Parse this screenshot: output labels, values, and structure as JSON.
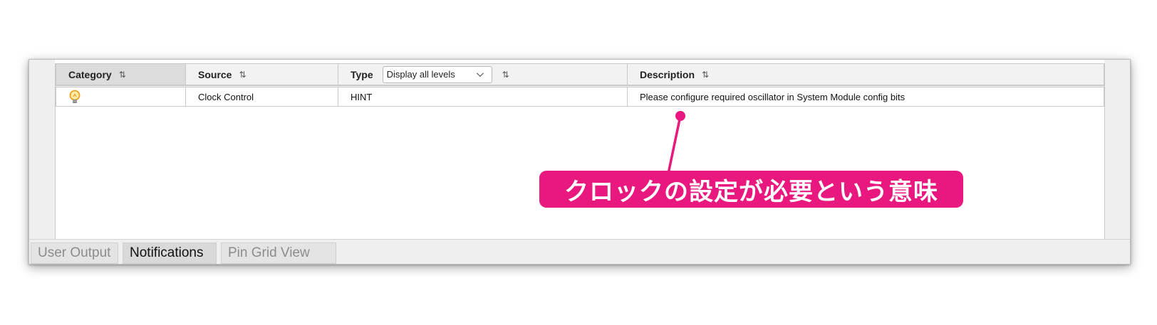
{
  "table": {
    "columns": [
      {
        "label": "Category",
        "sort_icon": "sort-arrows-icon"
      },
      {
        "label": "Source",
        "sort_icon": "sort-arrows-icon"
      },
      {
        "label": "Type",
        "sort_icon": "sort-arrows-icon",
        "filter_value": "Display all levels"
      },
      {
        "label": "Description",
        "sort_icon": "sort-arrows-icon"
      }
    ],
    "sort_glyph": "⇅",
    "rows": [
      {
        "category_icon": "lightbulb-hint-icon",
        "source": "Clock Control",
        "type": "HINT",
        "description": "Please configure required oscillator in System Module config bits"
      }
    ]
  },
  "tabs": [
    {
      "label": "User Output",
      "active": false
    },
    {
      "label": "Notifications",
      "active": true
    },
    {
      "label": "Pin Grid View",
      "active": false
    }
  ],
  "annotation": {
    "text": "クロックの設定が必要という意味",
    "color": "#e8187f"
  }
}
